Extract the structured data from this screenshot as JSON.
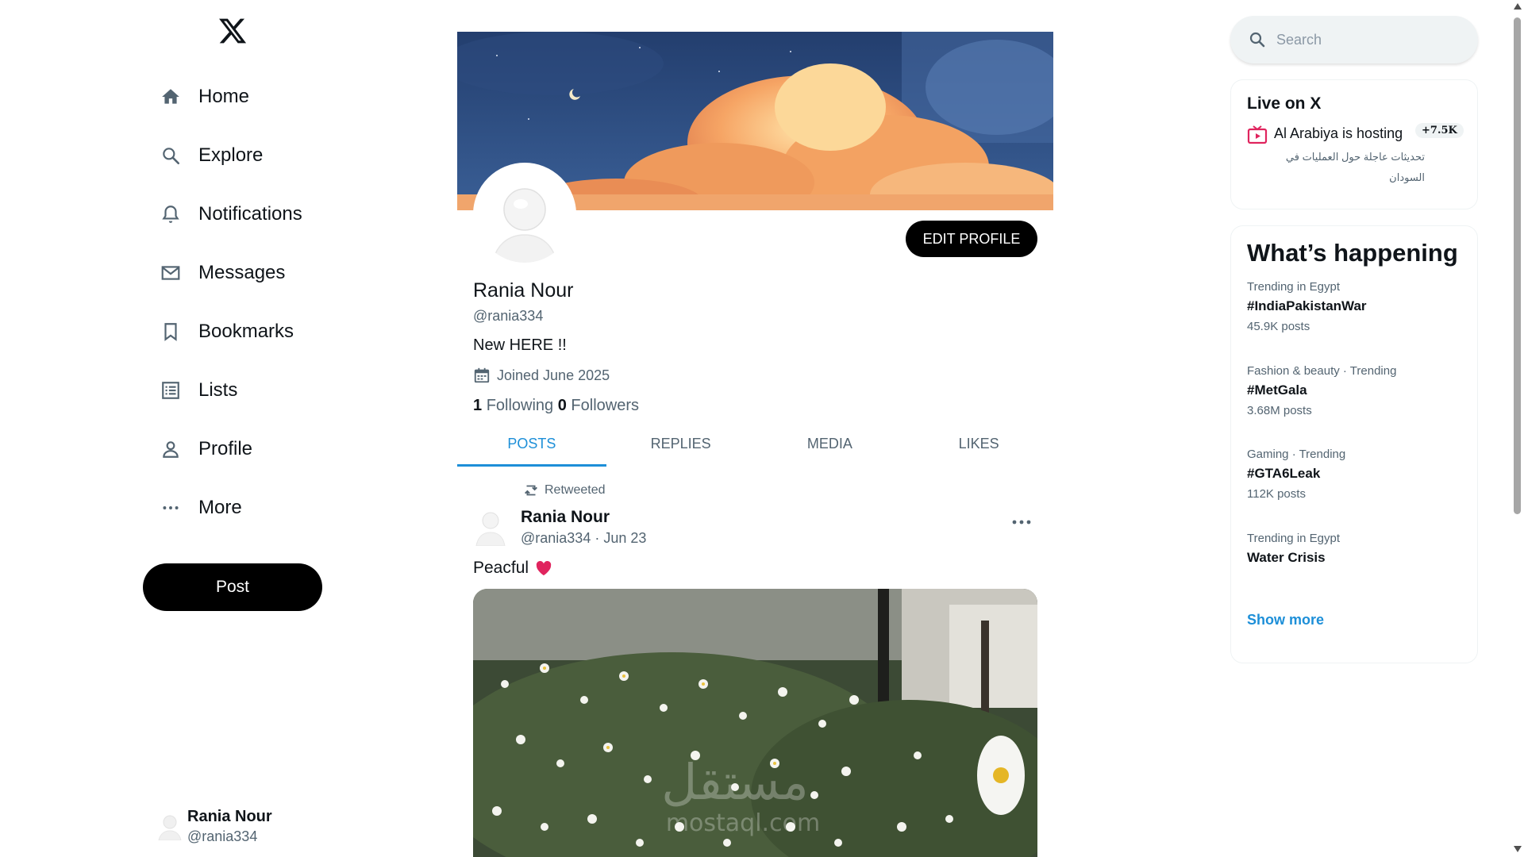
{
  "sidebar": {
    "logo_icon": "x-logo-icon",
    "items": [
      {
        "label": "Home",
        "icon": "home-icon"
      },
      {
        "label": "Explore",
        "icon": "search-icon"
      },
      {
        "label": "Notifications",
        "icon": "bell-icon"
      },
      {
        "label": "Messages",
        "icon": "envelope-icon"
      },
      {
        "label": "Bookmarks",
        "icon": "bookmark-icon"
      },
      {
        "label": "Lists",
        "icon": "list-icon"
      },
      {
        "label": "Profile",
        "icon": "person-icon"
      },
      {
        "label": "More",
        "icon": "more-icon"
      }
    ],
    "post_label": "Post",
    "account": {
      "name": "Rania Nour",
      "handle": "@rania334"
    }
  },
  "profile": {
    "edit_label": "EDIT PROFILE",
    "name": "Rania Nour",
    "handle": "@rania334",
    "bio": "New HERE !!",
    "joined": "Joined June 2025",
    "following_count": "1",
    "following_label": "Following",
    "followers_count": "0",
    "followers_label": "Followers"
  },
  "tabs": [
    {
      "label": "POSTS",
      "active": true
    },
    {
      "label": "REPLIES",
      "active": false
    },
    {
      "label": "MEDIA",
      "active": false
    },
    {
      "label": "LIKES",
      "active": false
    }
  ],
  "post": {
    "retweet_label": "Retweeted",
    "name": "Rania Nour",
    "meta": "@rania334 · Jun 23",
    "text": "Peacful",
    "image_watermark": "مستقل",
    "image_watermark_sub": "mostaql.com"
  },
  "search": {
    "placeholder": "Search"
  },
  "live": {
    "title": "Live on X",
    "host": "Al Arabiya is hosting",
    "badge": "+7.5K",
    "subtitle": "تحديثات عاجلة حول العمليات في السودان"
  },
  "happening": {
    "title": "What’s happening",
    "trends": [
      {
        "context": "Trending in Egypt",
        "title": "#IndiaPakistanWar",
        "count": "45.9K posts"
      },
      {
        "context": "Fashion & beauty · Trending",
        "title": "#MetGala",
        "count": "3.68M posts"
      },
      {
        "context": "Gaming · Trending",
        "title": "#GTA6Leak",
        "count": "112K posts"
      },
      {
        "context": "Trending in Egypt",
        "title": "Water Crisis",
        "count": ""
      }
    ],
    "show_more": "Show more"
  },
  "colors": {
    "accent": "#1d8fd8",
    "text": "#0f1419",
    "muted": "#536471",
    "heart": "#e0245e"
  }
}
